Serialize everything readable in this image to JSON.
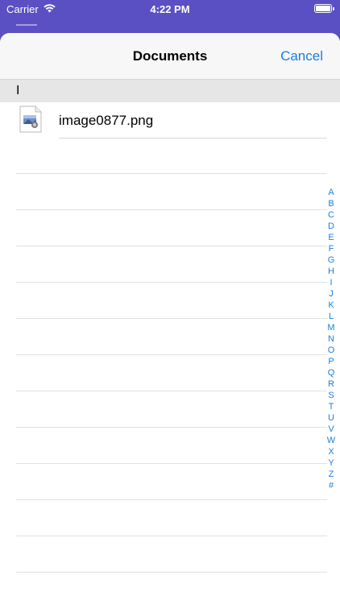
{
  "status_bar": {
    "carrier": "Carrier",
    "time": "4:22 PM",
    "icons": [
      "wifi-icon",
      "battery-icon"
    ]
  },
  "nav": {
    "title": "Documents",
    "cancel_label": "Cancel"
  },
  "section": {
    "header": "I"
  },
  "files": [
    {
      "name": "image0877.png",
      "icon": "image-file-icon"
    }
  ],
  "index_letters": [
    "A",
    "B",
    "C",
    "D",
    "E",
    "F",
    "G",
    "H",
    "I",
    "J",
    "K",
    "L",
    "M",
    "N",
    "O",
    "P",
    "Q",
    "R",
    "S",
    "T",
    "U",
    "V",
    "W",
    "X",
    "Y",
    "Z",
    "#"
  ],
  "colors": {
    "accent": "#1a7fe0",
    "header_bg": "#5b4fc4",
    "section_bg": "#e6e6e6"
  }
}
